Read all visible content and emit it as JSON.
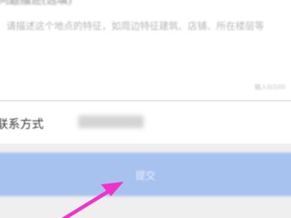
{
  "form": {
    "description": {
      "heading_partial": "问题描述(选填)",
      "placeholder": "请描述这个地点的特征，如周边特征建筑、店铺、所在楼层等",
      "counter": "输入0/100"
    },
    "contact": {
      "label": "联系方式",
      "value": ""
    },
    "submit": {
      "label": "提交"
    }
  },
  "annotation": {
    "arrow_color": "#f033c8"
  }
}
